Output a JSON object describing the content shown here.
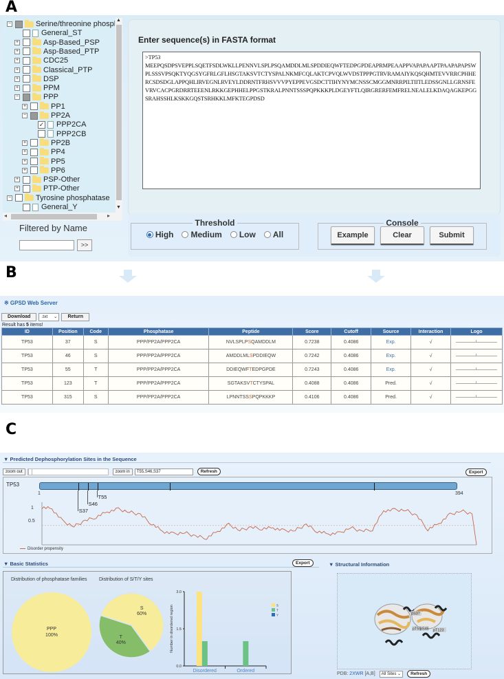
{
  "panel_labels": {
    "a": "A",
    "b": "B",
    "c": "C"
  },
  "panelA": {
    "tree": [
      {
        "label": "Serine/threonine phosphat",
        "level": 0,
        "toggle": "minus",
        "check": "partial",
        "type": "folder"
      },
      {
        "label": "General_ST",
        "level": 1,
        "toggle": "",
        "check": "none",
        "type": "doc"
      },
      {
        "label": "Asp-Based_PSP",
        "level": 1,
        "toggle": "plus",
        "check": "none",
        "type": "folder"
      },
      {
        "label": "Asp-Based_PTP",
        "level": 1,
        "toggle": "plus",
        "check": "none",
        "type": "folder"
      },
      {
        "label": "CDC25",
        "level": 1,
        "toggle": "plus",
        "check": "none",
        "type": "folder"
      },
      {
        "label": "Classical_PTP",
        "level": 1,
        "toggle": "plus",
        "check": "none",
        "type": "folder"
      },
      {
        "label": "DSP",
        "level": 1,
        "toggle": "plus",
        "check": "none",
        "type": "folder"
      },
      {
        "label": "PPM",
        "level": 1,
        "toggle": "plus",
        "check": "none",
        "type": "folder"
      },
      {
        "label": "PPP",
        "level": 1,
        "toggle": "minus",
        "check": "partial",
        "type": "folder"
      },
      {
        "label": "PP1",
        "level": 2,
        "toggle": "plus",
        "check": "none",
        "type": "folder"
      },
      {
        "label": "PP2A",
        "level": 2,
        "toggle": "minus",
        "check": "partial",
        "type": "folder"
      },
      {
        "label": "PPP2CA",
        "level": 3,
        "toggle": "",
        "check": "checked",
        "type": "doc"
      },
      {
        "label": "PPP2CB",
        "level": 3,
        "toggle": "",
        "check": "none",
        "type": "doc"
      },
      {
        "label": "PP2B",
        "level": 2,
        "toggle": "plus",
        "check": "none",
        "type": "folder"
      },
      {
        "label": "PP4",
        "level": 2,
        "toggle": "plus",
        "check": "none",
        "type": "folder"
      },
      {
        "label": "PP5",
        "level": 2,
        "toggle": "plus",
        "check": "none",
        "type": "folder"
      },
      {
        "label": "PP6",
        "level": 2,
        "toggle": "plus",
        "check": "none",
        "type": "folder"
      },
      {
        "label": "PSP-Other",
        "level": 1,
        "toggle": "plus",
        "check": "none",
        "type": "folder"
      },
      {
        "label": "PTP-Other",
        "level": 1,
        "toggle": "plus",
        "check": "none",
        "type": "folder"
      },
      {
        "label": "Tyrosine phosphatase",
        "level": 0,
        "toggle": "minus",
        "check": "none",
        "type": "folder"
      },
      {
        "label": "General_Y",
        "level": 1,
        "toggle": "",
        "check": "none",
        "type": "doc"
      }
    ],
    "filter_label": "Filtered by Name",
    "filter_value": "",
    "filter_button": ">>",
    "sequence_title": "Enter sequence(s) in FASTA format",
    "sequence_value": ">TP53\nMEEPQSDPSVEPPLSQETFSDLWKLLPENNVLSPLPSQAMDDLMLSPDDIEQWFTEDPGPDEAPRMPEAAPPVAPAPAAPTPAAPAPAPSWPLSSSVPSQKTYQGSYGFRLGFLHSGTAKSVTCTYSPALNKMFCQLAKTCPVQLWVDSTPPPGTRVRAMAIYKQSQHMTEVVRRCPHHERCSDSDGLAPPQHLIRVEGNLRVEYLDDRNTFRHSVVVPYEPPEVGSDCTTIHYNYMCNSSCMGGMNRRPILTIITLEDSSGNLLGRNSFEVRVCACPGRDRRTEEENLRKKGEPHHELPPGSTKRALPNNTSSSPQPKKKPLDGEYFTLQIRGRERFEMFRELNEALELKDAQAGKEPGGSRAHSSHLKSKKGQSTSRHKKLMFKTEGPDSD",
    "threshold": {
      "legend": "Threshold",
      "options": [
        "High",
        "Medium",
        "Low",
        "All"
      ],
      "selected": "High"
    },
    "console": {
      "legend": "Console",
      "buttons": [
        "Example",
        "Clear",
        "Submit"
      ]
    }
  },
  "panelB": {
    "title": "※ GPSD Web Server",
    "download_label": "Download",
    "format_selected": ".txt",
    "return_label": "Return",
    "result_prefix": "Result has ",
    "result_count": "5",
    "result_suffix": " items!",
    "columns": [
      "ID",
      "Position",
      "Code",
      "Phosphatase",
      "Peptide",
      "Score",
      "Cutoff",
      "Source",
      "Interaction",
      "Logo"
    ],
    "rows": [
      {
        "id": "TP53",
        "position": "37",
        "code": "S",
        "phosphatase": "PPP/PP2A/PPP2CA",
        "pep_pre": "NVLSPLP",
        "pep_site": "S",
        "pep_post": "QAMDDLM",
        "score": "0.7238",
        "cutoff": "0.4086",
        "source": "Exp.",
        "interaction": "√"
      },
      {
        "id": "TP53",
        "position": "46",
        "code": "S",
        "phosphatase": "PPP/PP2A/PPP2CA",
        "pep_pre": "AMDDLML",
        "pep_site": "S",
        "pep_post": "PDDIEQW",
        "score": "0.7242",
        "cutoff": "0.4086",
        "source": "Exp.",
        "interaction": "√"
      },
      {
        "id": "TP53",
        "position": "55",
        "code": "T",
        "phosphatase": "PPP/PP2A/PPP2CA",
        "pep_pre": "DDIEQWF",
        "pep_site": "T",
        "pep_post": "EDPGPDE",
        "score": "0.7243",
        "cutoff": "0.4086",
        "source": "Exp.",
        "interaction": "√"
      },
      {
        "id": "TP53",
        "position": "123",
        "code": "T",
        "phosphatase": "PPP/PP2A/PPP2CA",
        "pep_pre": "SGTAKSV",
        "pep_site": "T",
        "pep_post": "CTYSPAL",
        "score": "0.4088",
        "cutoff": "0.4086",
        "source": "Pred.",
        "interaction": "√"
      },
      {
        "id": "TP53",
        "position": "315",
        "code": "S",
        "phosphatase": "PPP/PP2A/PPP2CA",
        "pep_pre": "LPNNTSS",
        "pep_site": "S",
        "pep_post": "PQPKKKP",
        "score": "0.4106",
        "cutoff": "0.4086",
        "source": "Pred.",
        "interaction": "√"
      }
    ]
  },
  "panelC": {
    "seq_section_title": "▼ Predicted Dephosphorylation Sites in the Sequence",
    "zoom_out_label": "zoom out",
    "zoom_in_label": "zoom in",
    "sites_input": "T55,S46,S37",
    "refresh_label": "Refresh",
    "export_label": "Export",
    "protein": "TP53",
    "seq_start": "1",
    "seq_end": "394",
    "seq_length": 394,
    "sites": [
      {
        "label": "S37",
        "pos": 37
      },
      {
        "label": "S46",
        "pos": 46
      },
      {
        "label": "T55",
        "pos": 55
      }
    ],
    "other_ticks": [
      123,
      315
    ],
    "disorder_axis": [
      "1",
      "0.5"
    ],
    "disorder_legend": "Disorder propensity",
    "stats_title": "▼ Basic Statistics",
    "stats_export": "Export",
    "struct_title": "▼ Structural Information",
    "pdb_prefix": "PDB:",
    "pdb_id": "2XWR",
    "pdb_chains": "[A,B]",
    "sites_select": "All Sites",
    "struct_refresh": "Refresh",
    "struct_labels": [
      "pS37",
      "pT55",
      "pS46",
      "pT123"
    ]
  },
  "chart_data": [
    {
      "type": "line",
      "title": "",
      "series": [
        {
          "name": "Disorder propensity",
          "color": "#c8684c",
          "x": [
            1,
            10,
            20,
            30,
            40,
            50,
            60,
            70,
            80,
            90,
            100,
            110,
            120,
            130,
            140,
            150,
            160,
            170,
            180,
            190,
            200,
            210,
            220,
            230,
            240,
            250,
            260,
            270,
            280,
            290,
            300,
            310,
            320,
            330,
            340,
            350,
            360,
            370,
            380,
            390,
            394
          ],
          "values": [
            0.97,
            0.93,
            0.6,
            0.48,
            0.62,
            0.72,
            0.85,
            0.92,
            0.85,
            0.78,
            0.55,
            0.35,
            0.28,
            0.32,
            0.22,
            0.18,
            0.35,
            0.52,
            0.38,
            0.45,
            0.42,
            0.44,
            0.36,
            0.38,
            0.52,
            0.35,
            0.28,
            0.3,
            0.45,
            0.35,
            0.4,
            0.88,
            0.9,
            0.9,
            0.75,
            0.4,
            0.55,
            0.78,
            0.88,
            0.8,
            0.0
          ]
        }
      ],
      "xlim": [
        1,
        394
      ],
      "ylim": [
        0,
        1.1
      ],
      "yticks": [
        "1",
        "0.5"
      ],
      "reference_line": 0.5,
      "legend": "bottom-left"
    },
    {
      "type": "pie",
      "title": "Distribution of phosphatase families",
      "labels": [
        "PPP"
      ],
      "values": [
        100
      ],
      "colors": [
        "#f6ec9a"
      ]
    },
    {
      "type": "pie",
      "title": "Distribution of S/T/Y sites",
      "labels": [
        "S",
        "T"
      ],
      "values": [
        60,
        40
      ],
      "colors": [
        "#f6ec9a",
        "#86bd68"
      ]
    },
    {
      "type": "bar",
      "title": "",
      "categories": [
        "Disordered",
        "Ordered"
      ],
      "series": [
        {
          "name": "S",
          "values": [
            3,
            0
          ],
          "color": "#fde37f"
        },
        {
          "name": "T",
          "values": [
            1,
            1
          ],
          "color": "#6cc184"
        },
        {
          "name": "Y",
          "values": [
            0,
            0
          ],
          "color": "#2f6db5"
        }
      ],
      "ylabel": "Number in disordered region",
      "ylim": [
        0,
        3
      ],
      "yticks": [
        "0.0",
        "1.5",
        "3.0"
      ],
      "legend": "right"
    }
  ]
}
